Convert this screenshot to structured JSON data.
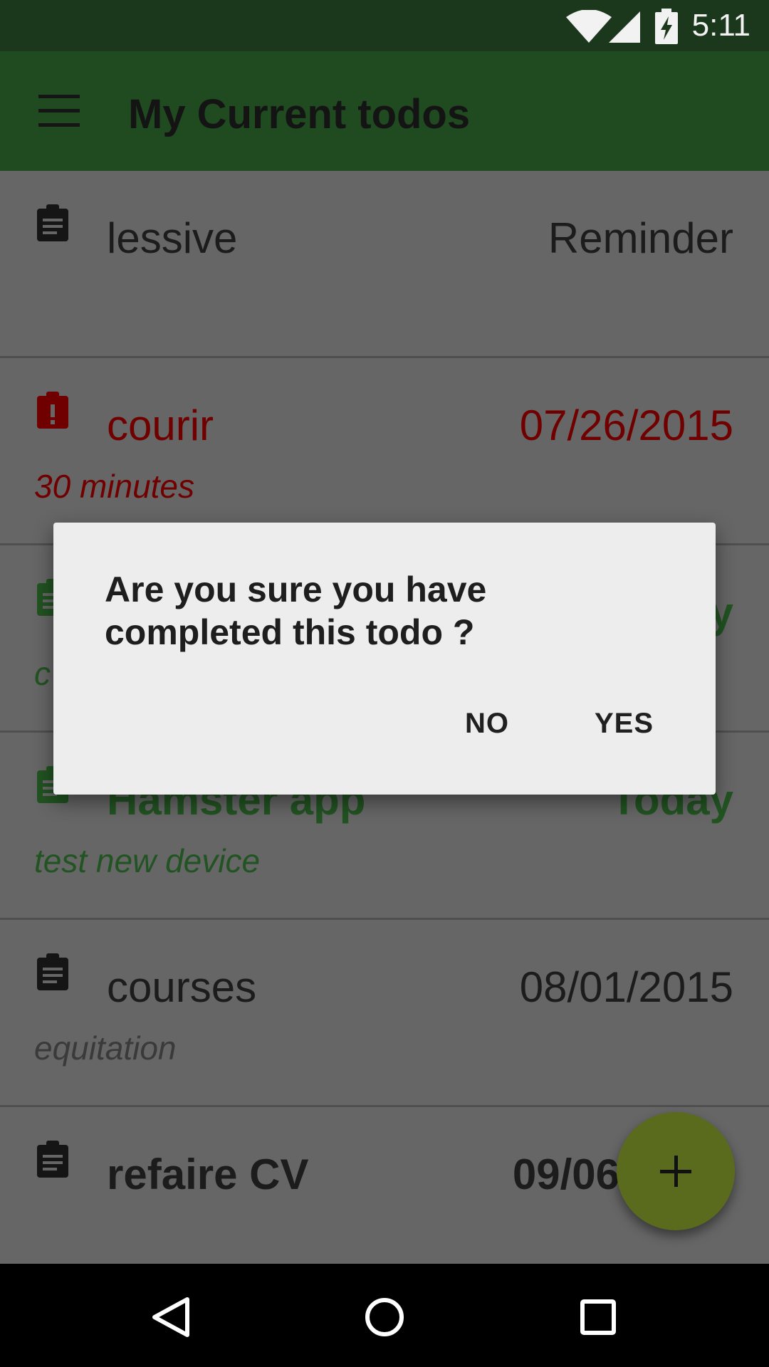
{
  "status_bar": {
    "time": "5:11",
    "icons": [
      "wifi-icon",
      "cell-signal-icon",
      "battery-charging-icon"
    ]
  },
  "toolbar": {
    "title": "My Current todos",
    "menu_icon": "hamburger-menu-icon"
  },
  "todos": [
    {
      "icon": "clipboard-icon",
      "name": "lessive",
      "right": "Reminder",
      "sub": "",
      "style": "normal"
    },
    {
      "icon": "clipboard-alert-icon",
      "name": "courir",
      "right": "07/26/2015",
      "sub": "30 minutes",
      "style": "overdue",
      "color": "#700000"
    },
    {
      "icon": "clipboard-icon",
      "name": "",
      "right": "y",
      "sub": "c",
      "style": "today",
      "color": "#225322"
    },
    {
      "icon": "clipboard-icon",
      "name": "Hamster app",
      "right": "Today",
      "sub": "test new device",
      "style": "today",
      "color": "#225322"
    },
    {
      "icon": "clipboard-icon",
      "name": "courses",
      "right": "08/01/2015",
      "sub": "equitation",
      "style": "normal"
    },
    {
      "icon": "clipboard-icon",
      "name": "refaire CV",
      "right": "09/06",
      "sub": "",
      "style": "bold"
    }
  ],
  "dialog": {
    "message": "Are you sure you have completed this todo ?",
    "no_label": "NO",
    "yes_label": "YES"
  },
  "fab": {
    "icon": "plus-icon",
    "color": "#5a6b1e"
  },
  "nav_bar": {
    "icons": [
      "back-icon",
      "home-icon",
      "recents-icon"
    ]
  }
}
